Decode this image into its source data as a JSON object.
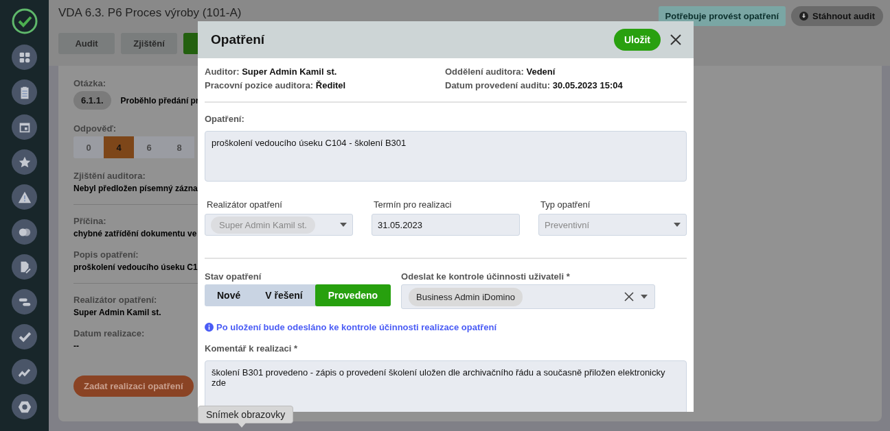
{
  "sidebar": {
    "items": [
      {
        "kind": "grid"
      },
      {
        "kind": "clipboard"
      },
      {
        "kind": "calendar"
      },
      {
        "kind": "star"
      },
      {
        "kind": "warning"
      },
      {
        "kind": "circles"
      },
      {
        "kind": "document"
      },
      {
        "kind": "bars"
      },
      {
        "kind": "check"
      },
      {
        "kind": "trend"
      },
      {
        "kind": "hexagon"
      }
    ]
  },
  "header": {
    "title": "VDA 6.3. P6 Proces výroby (101-A)",
    "status_badge": "Potřebuje provést opatření",
    "download_button": "Stáhnout audit"
  },
  "tabs": [
    {
      "label": "Audit",
      "selected": false
    },
    {
      "label": "Zjištění",
      "selected": false
    },
    {
      "selected": true
    }
  ],
  "card": {
    "question_label": "Otázka:",
    "question_number": "6.1.1.",
    "question_text": "Proběhlo předání pr",
    "answer_label": "Odpověď:",
    "answers": [
      {
        "label": "0",
        "selected": false
      },
      {
        "label": "4",
        "selected": true
      },
      {
        "label": "6",
        "selected": false
      },
      {
        "label": "8",
        "selected": false
      }
    ],
    "section_groups": [
      [
        {
          "label": "Zjištění auditora:",
          "value": "Nebyl předložen písemný zázna"
        }
      ],
      [
        {
          "label": "Příčina:",
          "value": "chybné zatřídění dokumentu ve"
        },
        {
          "label": "Popis opatření:",
          "value": "proškolení vedoucího úseku C1"
        }
      ],
      [
        {
          "label": "Realizátor opatření:",
          "value": "Super Admin Kamil st."
        },
        {
          "label": "Datum realizace:",
          "value": "--"
        }
      ]
    ],
    "action_button": "Zadat realizaci opatření"
  },
  "modal": {
    "title": "Opatření",
    "save_button": "Uložit",
    "info": [
      {
        "label": "Auditor:",
        "value": "Super Admin Kamil st."
      },
      {
        "label": "Oddělení auditora:",
        "value": "Vedení"
      },
      {
        "label": "Pracovní pozice auditora:",
        "value": "Ředitel"
      },
      {
        "label": "Datum provedení auditu:",
        "value": "30.05.2023 15:04"
      }
    ],
    "measure_label": "Opatření:",
    "measure_value": "proškolení vedoucího úseku C104 - školení B301",
    "fields": [
      {
        "kind": "chip-select",
        "label": "Realizátor opatření",
        "value": "Super Admin Kamil st.",
        "disabled": true
      },
      {
        "kind": "input",
        "label": "Termín pro realizaci",
        "value": "31.05.2023",
        "disabled": false
      },
      {
        "kind": "select",
        "label": "Typ opatření",
        "value": "Preventivní",
        "disabled": true
      }
    ],
    "state_label": "Stav opatření",
    "states": [
      {
        "label": "Nové",
        "selected": false
      },
      {
        "label": "V řešení",
        "selected": false
      },
      {
        "label": "Provedeno",
        "selected": true
      }
    ],
    "recipient_label": "Odeslat ke kontrole účinnosti uživateli *",
    "recipients": [
      "Business Admin iDomino"
    ],
    "notice": "Po uložení bude odesláno ke kontrole účinnosti realizace opatření",
    "comment_label": "Komentář k realizaci *",
    "comment_value": "školení B301 provedeno - zápis o provedení školení uložen dle archivačního řádu a současně přiložen elektronicky zde"
  },
  "tooltip": "Snímek obrazovky"
}
